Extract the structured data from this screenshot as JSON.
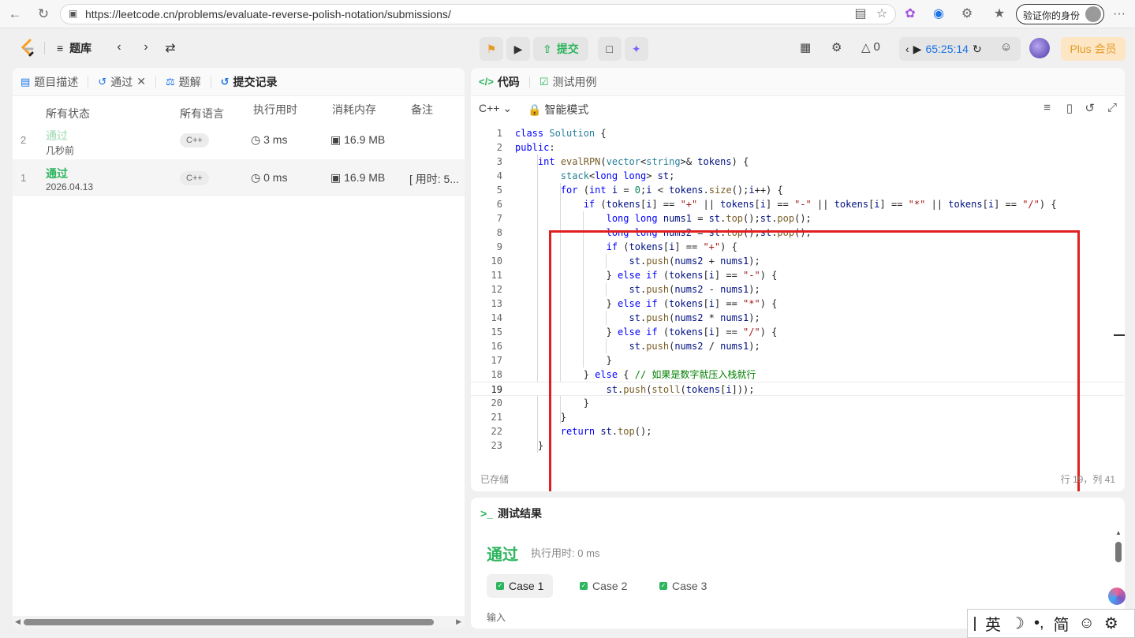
{
  "browser": {
    "url": "https://leetcode.cn/problems/evaluate-reverse-polish-notation/submissions/",
    "identity_label": "验证你的身份",
    "more": "···"
  },
  "topbar": {
    "problem_bank": "题库",
    "submit_label": "提交",
    "fire_count": "0",
    "timer": "65:25:14",
    "plus_label": "Plus 会员"
  },
  "left_tabs": {
    "description": "题目描述",
    "passed": "通过",
    "solutions": "题解",
    "submissions": "提交记录"
  },
  "table": {
    "headers": [
      "所有状态",
      "所有语言",
      "执行用时",
      "消耗内存",
      "备注"
    ],
    "rows": [
      {
        "index": "2",
        "status": "通过",
        "time_ago": "几秒前",
        "language": "C++",
        "runtime": "3 ms",
        "memory": "16.9 MB",
        "note": ""
      },
      {
        "index": "1",
        "status": "通过",
        "time_ago": "2026.04.13",
        "language": "C++",
        "runtime": "0 ms",
        "memory": "16.9 MB",
        "note": "[ 用时: 5..."
      }
    ]
  },
  "code_tabs": {
    "code": "代码",
    "testcase": "测试用例"
  },
  "editor": {
    "language": "C++",
    "mode": "智能模式",
    "saved": "已存储",
    "cursor": "行 19，列 41",
    "line_numbers": [
      "1",
      "2",
      "3",
      "4",
      "5",
      "6",
      "7",
      "8",
      "9",
      "10",
      "11",
      "12",
      "13",
      "14",
      "15",
      "16",
      "17",
      "18",
      "19",
      "20",
      "21",
      "22",
      "23"
    ]
  },
  "result": {
    "title": "测试结果",
    "status": "通过",
    "runtime": "执行用时: 0 ms",
    "cases": [
      "Case 1",
      "Case 2",
      "Case 3"
    ],
    "input_label": "输入"
  },
  "ime": {
    "lang": "英",
    "simplified": "简"
  },
  "colors": {
    "accent_green": "#2db55d",
    "highlight_red": "#e02020",
    "plus_orange": "#e59b27"
  }
}
